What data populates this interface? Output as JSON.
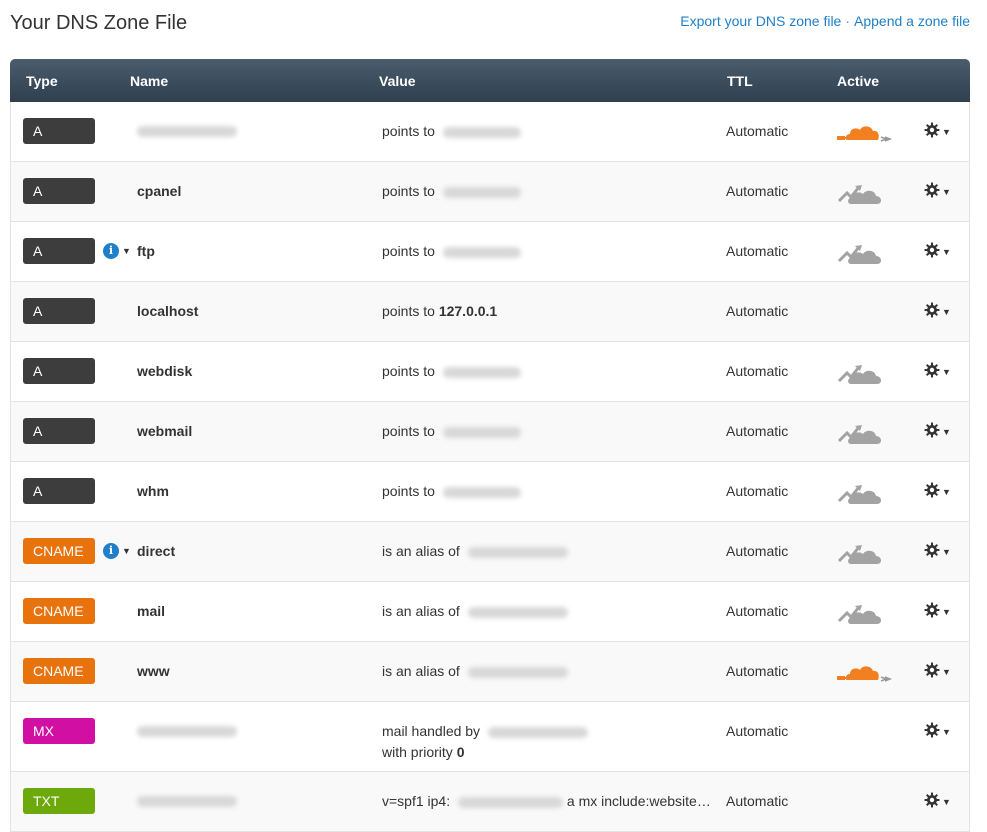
{
  "page": {
    "title": "Your DNS Zone File",
    "export_link": "Export your DNS zone file",
    "separator": "·",
    "append_link": "Append a zone file"
  },
  "columns": {
    "type": "Type",
    "name": "Name",
    "value": "Value",
    "ttl": "TTL",
    "active": "Active"
  },
  "colors": {
    "A": "#3d3d3d",
    "CNAME": "#e8720c",
    "MX": "#d10fa2",
    "TXT": "#6da90a",
    "cloud_on": "#f38020",
    "cloud_off": "#a3a3a3"
  },
  "records": [
    {
      "type": "A",
      "name": "",
      "prefix": "points to",
      "value": "",
      "suffix": "",
      "ttl": "Automatic",
      "proxy": "on",
      "info": false
    },
    {
      "type": "A",
      "name": "cpanel",
      "prefix": "points to",
      "value": "",
      "suffix": "",
      "ttl": "Automatic",
      "proxy": "off",
      "info": false
    },
    {
      "type": "A",
      "name": "ftp",
      "prefix": "points to",
      "value": "",
      "suffix": "",
      "ttl": "Automatic",
      "proxy": "off",
      "info": true
    },
    {
      "type": "A",
      "name": "localhost",
      "prefix": "points to",
      "value": "127.0.0.1",
      "suffix": "",
      "ttl": "Automatic",
      "proxy": "none",
      "info": false
    },
    {
      "type": "A",
      "name": "webdisk",
      "prefix": "points to",
      "value": "",
      "suffix": "",
      "ttl": "Automatic",
      "proxy": "off",
      "info": false
    },
    {
      "type": "A",
      "name": "webmail",
      "prefix": "points to",
      "value": "",
      "suffix": "",
      "ttl": "Automatic",
      "proxy": "off",
      "info": false
    },
    {
      "type": "A",
      "name": "whm",
      "prefix": "points to",
      "value": "",
      "suffix": "",
      "ttl": "Automatic",
      "proxy": "off",
      "info": false
    },
    {
      "type": "CNAME",
      "name": "direct",
      "prefix": "is an alias of",
      "value": "",
      "suffix": "",
      "ttl": "Automatic",
      "proxy": "off",
      "info": true
    },
    {
      "type": "CNAME",
      "name": "mail",
      "prefix": "is an alias of",
      "value": "",
      "suffix": "",
      "ttl": "Automatic",
      "proxy": "off",
      "info": false
    },
    {
      "type": "CNAME",
      "name": "www",
      "prefix": "is an alias of",
      "value": "",
      "suffix": "",
      "ttl": "Automatic",
      "proxy": "on",
      "info": false
    },
    {
      "type": "MX",
      "name": "",
      "prefix": "mail handled by",
      "value": "",
      "suffix": "",
      "line2": "with priority",
      "line2_value": "0",
      "ttl": "Automatic",
      "proxy": "none",
      "info": false
    },
    {
      "type": "TXT",
      "name": "",
      "prefix": "v=spf1 ip4:",
      "value": "",
      "suffix": "a mx include:website…",
      "ttl": "Automatic",
      "proxy": "none",
      "info": false
    }
  ]
}
